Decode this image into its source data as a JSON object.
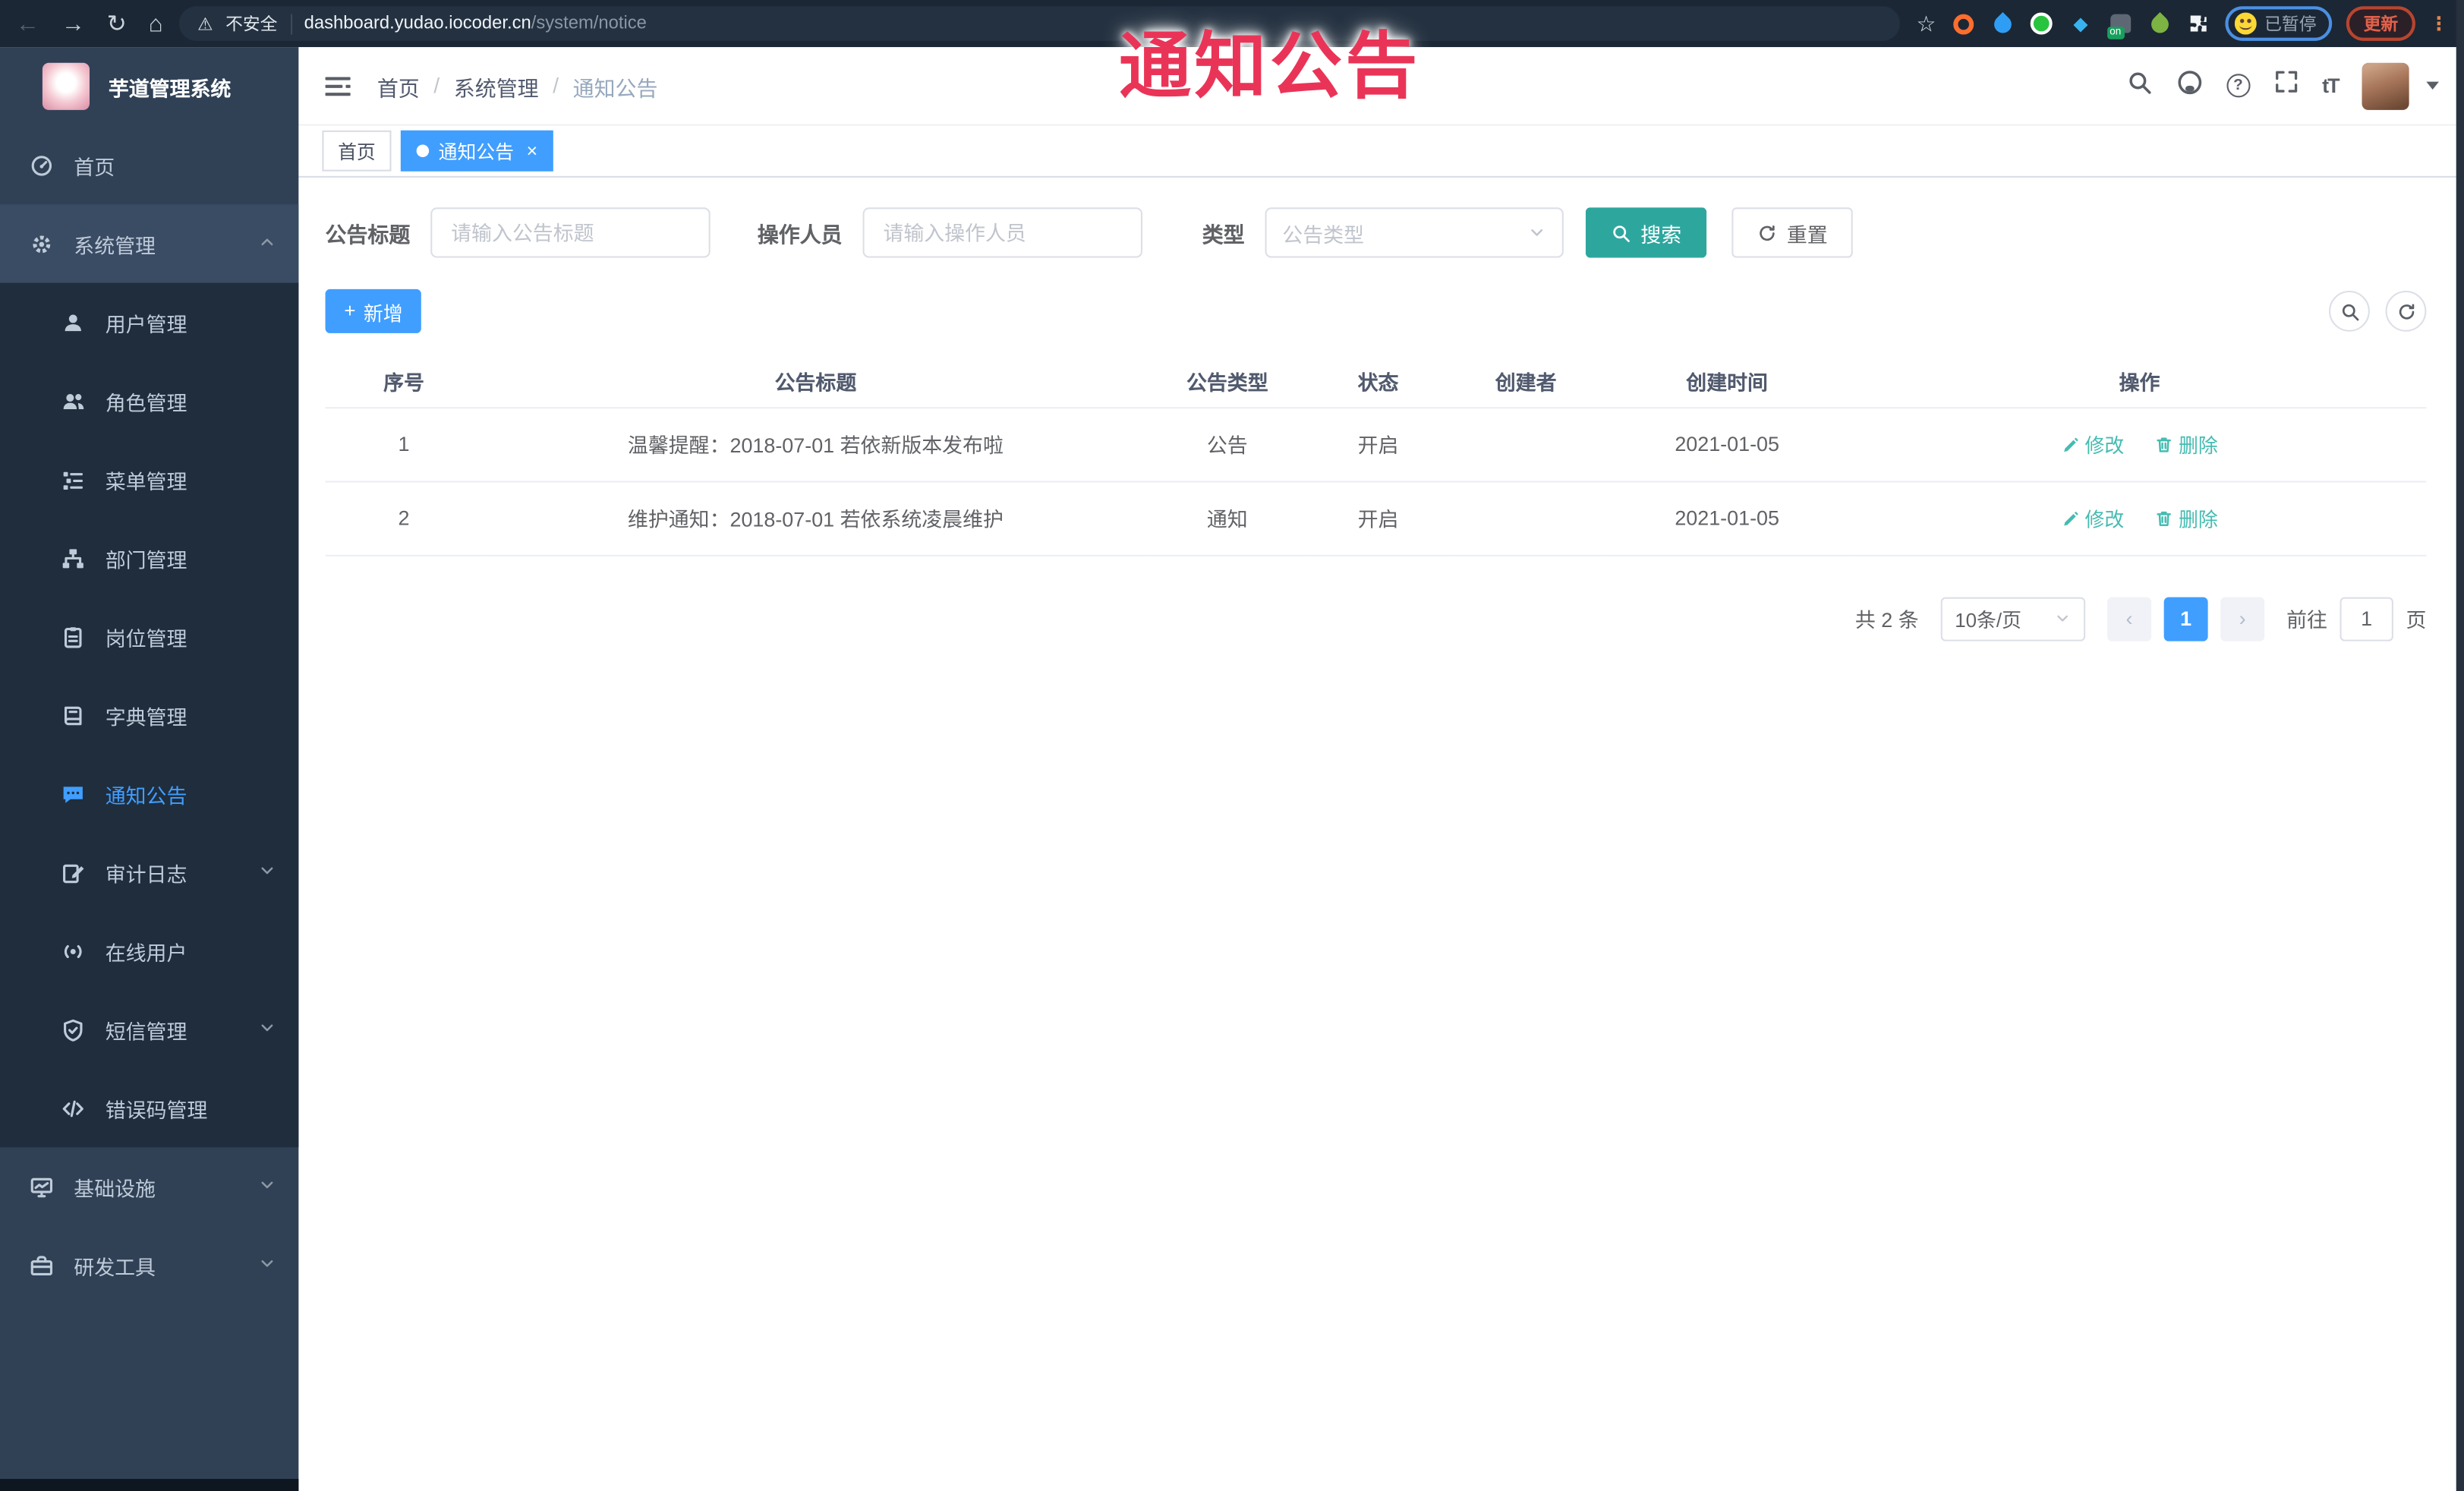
{
  "browser": {
    "insecure_label": "不安全",
    "url_host": "dashboard.yudao.iocoder.cn",
    "url_path": "/system/notice",
    "ext_on_badge": "on",
    "paused_label": "已暂停",
    "update_label": "更新",
    "menu_dots": "⋮"
  },
  "icons": {
    "back": "←",
    "forward": "→",
    "reload": "↻",
    "home": "⌂",
    "star": "☆",
    "warning": "⚠",
    "gem": "◆",
    "question": "?",
    "font_size": "tT",
    "close": "×",
    "plus": "+",
    "chevron_prev": "‹",
    "chevron_next": "›"
  },
  "overlay": {
    "title": "通知公告"
  },
  "sidebar": {
    "title": "芋道管理系统",
    "items": [
      {
        "label": "首页"
      },
      {
        "label": "系统管理"
      },
      {
        "label": "用户管理"
      },
      {
        "label": "角色管理"
      },
      {
        "label": "菜单管理"
      },
      {
        "label": "部门管理"
      },
      {
        "label": "岗位管理"
      },
      {
        "label": "字典管理"
      },
      {
        "label": "通知公告"
      },
      {
        "label": "审计日志"
      },
      {
        "label": "在线用户"
      },
      {
        "label": "短信管理"
      },
      {
        "label": "错误码管理"
      },
      {
        "label": "基础设施"
      },
      {
        "label": "研发工具"
      }
    ]
  },
  "navbar": {
    "breadcrumb": [
      "首页",
      "系统管理",
      "通知公告"
    ],
    "separator": "/"
  },
  "tabs": [
    {
      "label": "首页"
    },
    {
      "label": "通知公告"
    }
  ],
  "filters": {
    "title_label": "公告标题",
    "title_placeholder": "请输入公告标题",
    "operator_label": "操作人员",
    "operator_placeholder": "请输入操作人员",
    "type_label": "类型",
    "type_placeholder": "公告类型",
    "search_label": "搜索",
    "reset_label": "重置"
  },
  "toolbar": {
    "add_label": "新增"
  },
  "table": {
    "columns": [
      "序号",
      "公告标题",
      "公告类型",
      "状态",
      "创建者",
      "创建时间",
      "操作"
    ],
    "rows": [
      {
        "no": "1",
        "title": "温馨提醒：2018-07-01 若依新版本发布啦",
        "type": "公告",
        "status": "开启",
        "creator": "",
        "created": "2021-01-05"
      },
      {
        "no": "2",
        "title": "维护通知：2018-07-01 若依系统凌晨维护",
        "type": "通知",
        "status": "开启",
        "creator": "",
        "created": "2021-01-05"
      }
    ],
    "edit_label": "修改",
    "delete_label": "删除"
  },
  "pagination": {
    "total": "共 2 条",
    "page_size": "10条/页",
    "current_page": "1",
    "goto_label": "前往",
    "goto_value": "1",
    "unit_label": "页"
  },
  "colors": {
    "accent": "#409EFF",
    "search_button": "#2DA79E",
    "action_link": "#45BCB1",
    "overlay": "#EA3457"
  }
}
